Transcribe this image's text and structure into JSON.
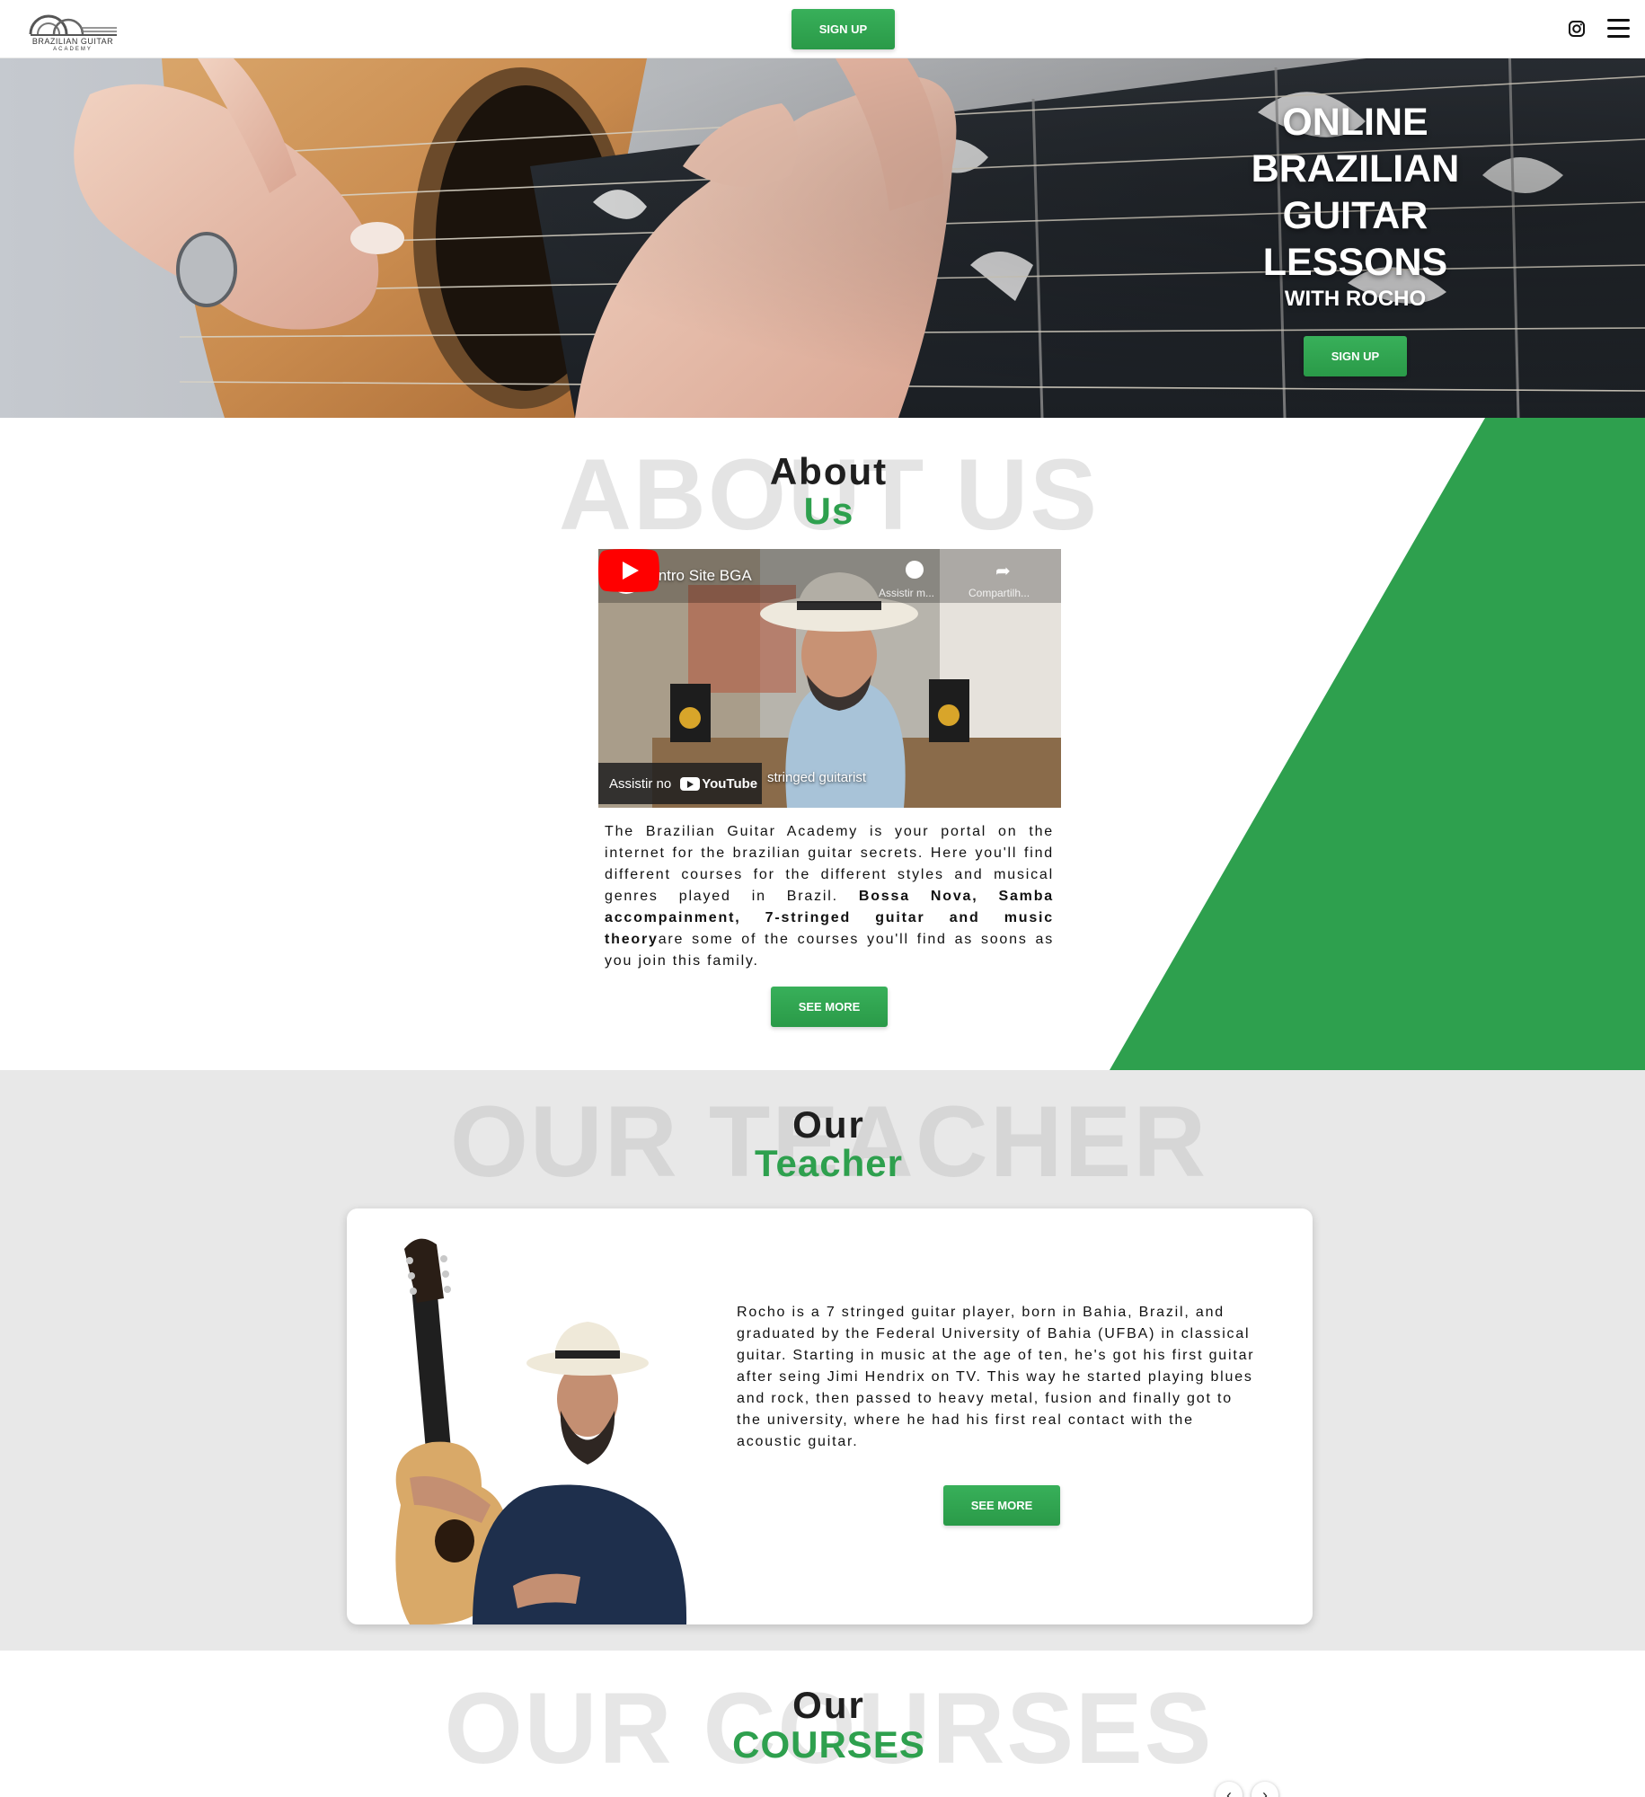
{
  "navbar": {
    "logo_text": "BRAZILIAN GUITAR",
    "logo_sub": "ACADEMY",
    "signup_label": "SIGN UP",
    "instagram_icon": "instagram-icon",
    "menu_icon": "hamburger-menu-icon"
  },
  "hero": {
    "title": "ONLINE BRAZILIAN GUITAR LESSONS",
    "subtitle": "WITH ROCHO",
    "signup_label": "SIGN UP"
  },
  "about": {
    "ghost": "ABOUT US",
    "title_1": "About",
    "title_2": "Us",
    "video": {
      "title": "Intro Site BGA",
      "watch_later": "Assistir m...",
      "share": "Compartilh...",
      "caption": "stringed guitarist",
      "watch_on": "Assistir no",
      "youtube": "YouTube"
    },
    "text_1": "The Brazilian Guitar Academy is your portal on the internet for the brazilian guitar secrets. Here you'll find different courses for the different styles and musical genres played in Brazil. ",
    "text_bold": "Bossa Nova, Samba accompainment, 7-stringed guitar and music theory",
    "text_2": "are some of the courses you'll find as soons as you join this family.",
    "see_more_label": "SEE MORE"
  },
  "teacher": {
    "ghost": "OUR TEACHER",
    "title_1": "Our",
    "title_2": "Teacher",
    "bio": "Rocho is a 7 stringed guitar player, born in Bahia, Brazil, and graduated by the Federal University of Bahia (UFBA) in classical guitar. Starting in music at the age of ten, he's got his first guitar after seing Jimi Hendrix on TV. This way he started playing blues and rock, then passed to heavy metal, fusion and finally got to the university, where he had his first real contact with the acoustic guitar.",
    "see_more_label": "SEE MORE"
  },
  "courses": {
    "ghost": "OUR COURSES",
    "title_1": "Our",
    "title_2": "COURSES",
    "prev_icon": "chevron-left-icon",
    "next_icon": "chevron-right-icon"
  },
  "colors": {
    "accent": "#2ea04e",
    "ghost": "#e4e4e4",
    "section_gray": "#e8e8e8"
  }
}
